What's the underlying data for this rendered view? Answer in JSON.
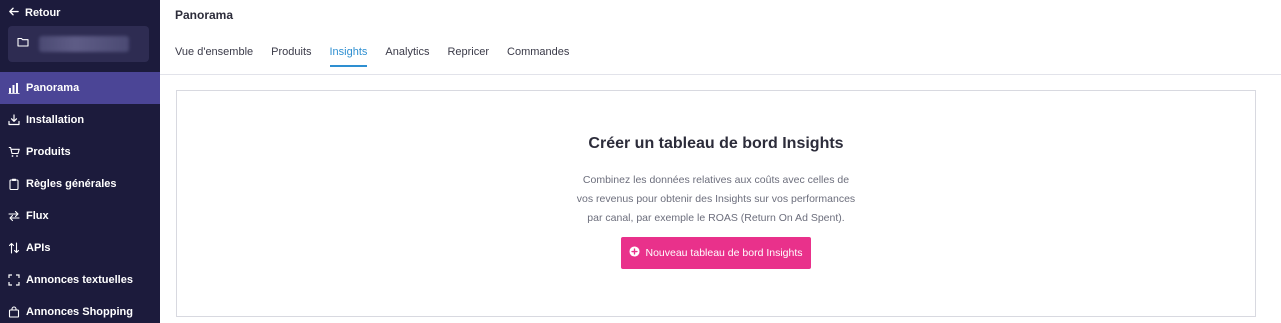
{
  "sidebar": {
    "back_label": "Retour",
    "items": [
      {
        "label": "Panorama",
        "icon": "bar-chart-icon",
        "active": true
      },
      {
        "label": "Installation",
        "icon": "download-tray-icon",
        "active": false
      },
      {
        "label": "Produits",
        "icon": "cart-icon",
        "active": false
      },
      {
        "label": "Règles générales",
        "icon": "clipboard-icon",
        "active": false
      },
      {
        "label": "Flux",
        "icon": "swap-arrows-icon",
        "active": false
      },
      {
        "label": "APIs",
        "icon": "up-down-arrows-icon",
        "active": false
      },
      {
        "label": "Annonces textuelles",
        "icon": "brackets-icon",
        "active": false
      },
      {
        "label": "Annonces Shopping",
        "icon": "shopping-bag-icon",
        "active": false
      }
    ]
  },
  "header": {
    "title": "Panorama",
    "tabs": [
      {
        "label": "Vue d'ensemble",
        "active": false
      },
      {
        "label": "Produits",
        "active": false
      },
      {
        "label": "Insights",
        "active": true
      },
      {
        "label": "Analytics",
        "active": false
      },
      {
        "label": "Repricer",
        "active": false
      },
      {
        "label": "Commandes",
        "active": false
      }
    ]
  },
  "card": {
    "title": "Créer un tableau de bord Insights",
    "description_lines": [
      "Combinez les données relatives aux coûts avec celles de",
      "vos revenus pour obtenir des Insights sur vos performances",
      "par canal, par exemple le ROAS (Return On Ad Spent)."
    ],
    "button_label": "Nouveau tableau de bord Insights"
  },
  "colors": {
    "sidebar_bg": "#1c1b3c",
    "sidebar_active": "#4b4596",
    "tab_active": "#2e8fd1",
    "cta": "#e9318b"
  }
}
